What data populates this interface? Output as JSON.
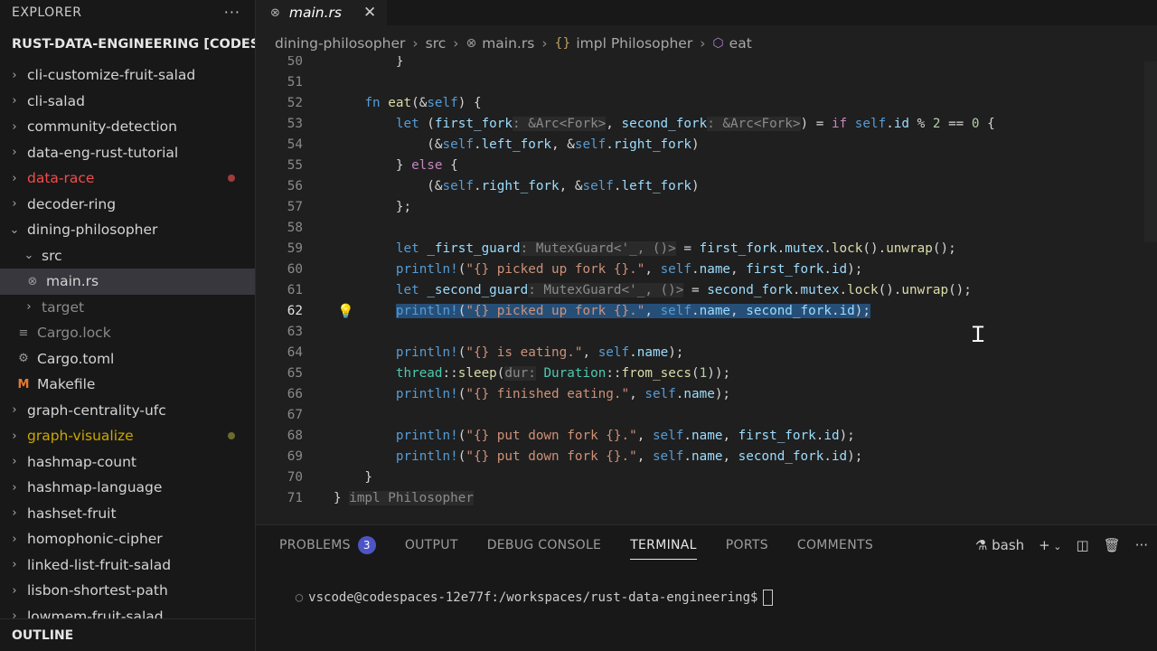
{
  "explorer": {
    "title": "EXPLORER",
    "more": "···",
    "root": "RUST-DATA-ENGINEERING [CODES...",
    "items": [
      {
        "label": "cli-customize-fruit-salad",
        "chev": "›",
        "color": "#d4d4d4",
        "dot": null
      },
      {
        "label": "cli-salad",
        "chev": "›",
        "color": "#d4d4d4",
        "dot": null
      },
      {
        "label": "community-detection",
        "chev": "›",
        "color": "#d4d4d4",
        "dot": null
      },
      {
        "label": "data-eng-rust-tutorial",
        "chev": "›",
        "color": "#d4d4d4",
        "dot": null
      },
      {
        "label": "data-race",
        "chev": "›",
        "color": "#f14c4c",
        "dot": "#a33b3b"
      },
      {
        "label": "decoder-ring",
        "chev": "›",
        "color": "#d4d4d4",
        "dot": null
      },
      {
        "label": "dining-philosopher",
        "chev": "⌄",
        "color": "#d4d4d4",
        "dot": null
      }
    ],
    "src": {
      "label": "src",
      "chev": "⌄"
    },
    "main_rs": {
      "label": "main.rs",
      "icon": "⊗"
    },
    "target": {
      "label": "target",
      "chev": "›"
    },
    "cargo_lock": {
      "label": "Cargo.lock",
      "icon": "≡"
    },
    "cargo_toml": {
      "label": "Cargo.toml",
      "icon": "⚙"
    },
    "makefile": {
      "label": "Makefile",
      "icon": "M"
    },
    "items_after": [
      {
        "label": "graph-centrality-ufc",
        "chev": "›",
        "color": "#d4d4d4",
        "dot": null
      },
      {
        "label": "graph-visualize",
        "chev": "›",
        "color": "#cca700",
        "dot": "#6b6b2e"
      },
      {
        "label": "hashmap-count",
        "chev": "›",
        "color": "#d4d4d4",
        "dot": null
      },
      {
        "label": "hashmap-language",
        "chev": "›",
        "color": "#d4d4d4",
        "dot": null
      },
      {
        "label": "hashset-fruit",
        "chev": "›",
        "color": "#d4d4d4",
        "dot": null
      },
      {
        "label": "homophonic-cipher",
        "chev": "›",
        "color": "#d4d4d4",
        "dot": null
      },
      {
        "label": "linked-list-fruit-salad",
        "chev": "›",
        "color": "#d4d4d4",
        "dot": null
      },
      {
        "label": "lisbon-shortest-path",
        "chev": "›",
        "color": "#d4d4d4",
        "dot": null
      },
      {
        "label": "lowmem-fruit-salad",
        "chev": "›",
        "color": "#d4d4d4",
        "dot": null
      }
    ],
    "outline": "OUTLINE"
  },
  "editor": {
    "tab": {
      "icon": "⊗",
      "label": "main.rs",
      "close": "✕"
    },
    "breadcrumb": [
      "dining-philosopher",
      "src",
      "main.rs",
      "impl Philosopher",
      "eat"
    ],
    "breadcrumb_sep": "›",
    "line_numbers": [
      "50",
      "51",
      "52",
      "53",
      "54",
      "55",
      "56",
      "57",
      "58",
      "59",
      "60",
      "61",
      "62",
      "63",
      "64",
      "65",
      "66",
      "67",
      "68",
      "69",
      "70",
      "71"
    ],
    "current_line": "62"
  },
  "panel": {
    "tabs": [
      "PROBLEMS",
      "OUTPUT",
      "DEBUG CONSOLE",
      "TERMINAL",
      "PORTS",
      "COMMENTS"
    ],
    "active_tab": "TERMINAL",
    "problems_count": "3",
    "shell": "bash",
    "add": "+",
    "prompt": "vscode@codespaces-12e77f:/workspaces/rust-data-engineering$"
  },
  "colors": {
    "accent": "#4d55c4",
    "selection": "#264f78",
    "background": "#1e1e1e"
  }
}
